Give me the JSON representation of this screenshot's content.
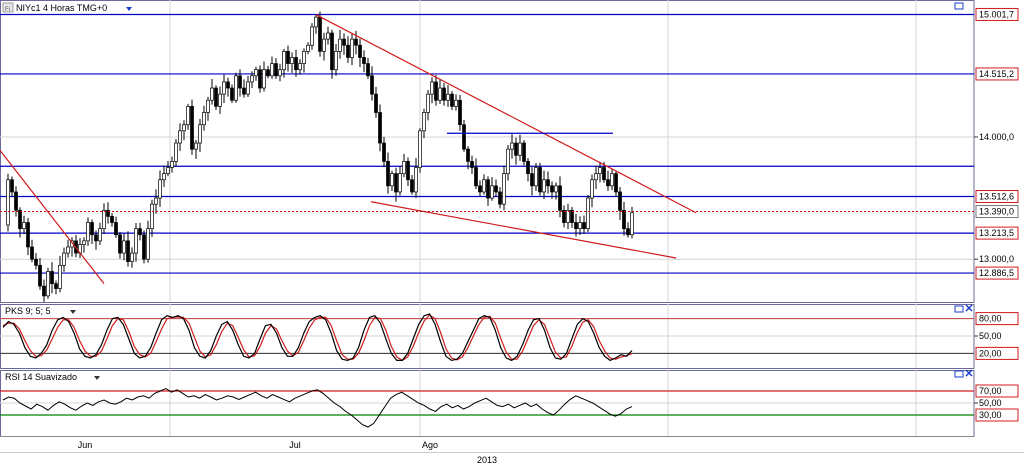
{
  "chart_title": "NIYc1 4 Horas TMG+0",
  "colors": {
    "background": "#ffffff",
    "grid": "#d4d4d4",
    "price_level": "#0000c8",
    "trendline": "#d01c1c",
    "current_price": "#c00000",
    "candle_up": "#ffffff",
    "candle_down": "#000000",
    "stoch_k": "#000000",
    "stoch_d": "#d01c1c",
    "rsi_line": "#000000",
    "rsi_upper": "#d01c1c",
    "rsi_lower": "#008000"
  },
  "icons": [
    "chart-icon",
    "dropdown-arrow-icon",
    "maximize-icon",
    "close-icon"
  ],
  "chart_data": [
    {
      "type": "candlestick",
      "title": "NIYc1 4 Horas TMG+0",
      "ylim": [
        12650,
        15120
      ],
      "y_ticks": [
        13000,
        14000
      ],
      "y_tick_labels": [
        "13.000,0",
        "14.000,0"
      ],
      "grid": true,
      "price_labels": [
        {
          "value": 15001.7,
          "label": "15.001,7"
        },
        {
          "value": 14515.2,
          "label": "14.515,2"
        },
        {
          "value": 13512.6,
          "label": "13.512,6"
        },
        {
          "value": 13390.0,
          "label": "13.390,0"
        },
        {
          "value": 13213.5,
          "label": "13.213,5"
        },
        {
          "value": 12886.5,
          "label": "12.886,5"
        }
      ],
      "horizontal_levels": [
        15001.7,
        14515.2,
        13760,
        13512.6,
        13213.5,
        12886.5
      ],
      "current_price": 13390.0,
      "trendlines": [
        {
          "x": [
            0,
            104
          ],
          "y": [
            13890,
            12800
          ]
        },
        {
          "x": [
            316,
            696
          ],
          "y": [
            15000,
            13380
          ]
        },
        {
          "x": [
            371,
            676
          ],
          "y": [
            13470,
            13010
          ]
        },
        {
          "x": [
            447,
            613
          ],
          "y": [
            14030,
            14030
          ]
        }
      ],
      "close_path": [
        [
          3,
          13280
        ],
        [
          8,
          13650
        ],
        [
          12,
          13550
        ],
        [
          16,
          13400
        ],
        [
          20,
          13250
        ],
        [
          24,
          13300
        ],
        [
          28,
          13100
        ],
        [
          32,
          13000
        ],
        [
          36,
          12950
        ],
        [
          40,
          12780
        ],
        [
          44,
          12700
        ],
        [
          48,
          12900
        ],
        [
          52,
          12800
        ],
        [
          56,
          12760
        ],
        [
          60,
          12950
        ],
        [
          64,
          13050
        ],
        [
          68,
          13100
        ],
        [
          72,
          13150
        ],
        [
          76,
          13050
        ],
        [
          80,
          13120
        ],
        [
          84,
          13150
        ],
        [
          88,
          13300
        ],
        [
          92,
          13200
        ],
        [
          96,
          13150
        ],
        [
          100,
          13250
        ],
        [
          104,
          13400
        ],
        [
          108,
          13350
        ],
        [
          112,
          13300
        ],
        [
          116,
          13200
        ],
        [
          120,
          13050
        ],
        [
          124,
          13150
        ],
        [
          128,
          12980
        ],
        [
          132,
          13050
        ],
        [
          136,
          13250
        ],
        [
          140,
          13200
        ],
        [
          144,
          13000
        ],
        [
          148,
          13250
        ],
        [
          152,
          13450
        ],
        [
          156,
          13500
        ],
        [
          160,
          13650
        ],
        [
          164,
          13700
        ],
        [
          168,
          13750
        ],
        [
          172,
          13800
        ],
        [
          176,
          13950
        ],
        [
          180,
          14050
        ],
        [
          184,
          14100
        ],
        [
          188,
          14250
        ],
        [
          192,
          13900
        ],
        [
          196,
          13950
        ],
        [
          200,
          14100
        ],
        [
          204,
          14200
        ],
        [
          208,
          14300
        ],
        [
          212,
          14400
        ],
        [
          216,
          14250
        ],
        [
          220,
          14350
        ],
        [
          224,
          14450
        ],
        [
          228,
          14400
        ],
        [
          232,
          14300
        ],
        [
          236,
          14500
        ],
        [
          240,
          14400
        ],
        [
          244,
          14350
        ],
        [
          248,
          14450
        ],
        [
          252,
          14500
        ],
        [
          256,
          14550
        ],
        [
          260,
          14400
        ],
        [
          264,
          14550
        ],
        [
          268,
          14500
        ],
        [
          272,
          14600
        ],
        [
          276,
          14500
        ],
        [
          280,
          14550
        ],
        [
          284,
          14700
        ],
        [
          288,
          14600
        ],
        [
          292,
          14650
        ],
        [
          296,
          14550
        ],
        [
          300,
          14600
        ],
        [
          304,
          14700
        ],
        [
          308,
          14750
        ],
        [
          312,
          14900
        ],
        [
          316,
          14980
        ],
        [
          320,
          14700
        ],
        [
          324,
          14800
        ],
        [
          328,
          14850
        ],
        [
          332,
          14550
        ],
        [
          336,
          14700
        ],
        [
          340,
          14800
        ],
        [
          344,
          14750
        ],
        [
          348,
          14650
        ],
        [
          352,
          14800
        ],
        [
          356,
          14750
        ],
        [
          360,
          14650
        ],
        [
          364,
          14600
        ],
        [
          368,
          14500
        ],
        [
          372,
          14350
        ],
        [
          376,
          14200
        ],
        [
          380,
          13950
        ],
        [
          384,
          13800
        ],
        [
          388,
          13600
        ],
        [
          392,
          13700
        ],
        [
          396,
          13550
        ],
        [
          400,
          13700
        ],
        [
          404,
          13800
        ],
        [
          408,
          13650
        ],
        [
          412,
          13550
        ],
        [
          416,
          13750
        ],
        [
          420,
          14050
        ],
        [
          424,
          14200
        ],
        [
          428,
          14350
        ],
        [
          432,
          14450
        ],
        [
          436,
          14300
        ],
        [
          440,
          14400
        ],
        [
          444,
          14300
        ],
        [
          448,
          14350
        ],
        [
          452,
          14250
        ],
        [
          456,
          14300
        ],
        [
          460,
          14100
        ],
        [
          464,
          13900
        ],
        [
          468,
          13800
        ],
        [
          472,
          13750
        ],
        [
          476,
          13600
        ],
        [
          480,
          13550
        ],
        [
          484,
          13650
        ],
        [
          488,
          13500
        ],
        [
          492,
          13600
        ],
        [
          496,
          13550
        ],
        [
          500,
          13450
        ],
        [
          504,
          13700
        ],
        [
          508,
          13900
        ],
        [
          512,
          13950
        ],
        [
          516,
          13850
        ],
        [
          520,
          13950
        ],
        [
          524,
          13800
        ],
        [
          528,
          13700
        ],
        [
          532,
          13600
        ],
        [
          536,
          13750
        ],
        [
          540,
          13550
        ],
        [
          544,
          13650
        ],
        [
          548,
          13600
        ],
        [
          552,
          13550
        ],
        [
          556,
          13600
        ],
        [
          560,
          13400
        ],
        [
          564,
          13300
        ],
        [
          568,
          13400
        ],
        [
          572,
          13300
        ],
        [
          576,
          13250
        ],
        [
          580,
          13300
        ],
        [
          584,
          13250
        ],
        [
          588,
          13500
        ],
        [
          592,
          13650
        ],
        [
          596,
          13700
        ],
        [
          600,
          13750
        ],
        [
          604,
          13650
        ],
        [
          608,
          13600
        ],
        [
          612,
          13700
        ],
        [
          616,
          13550
        ],
        [
          620,
          13400
        ],
        [
          624,
          13250
        ],
        [
          628,
          13200
        ],
        [
          632,
          13380
        ]
      ]
    },
    {
      "type": "line",
      "title": "PKS 9; 5; 5",
      "ylim": [
        0,
        100
      ],
      "y_ticks": [
        20,
        50,
        80
      ],
      "y_tick_labels": [
        "20,00",
        "50,00",
        "80,00"
      ],
      "reference_lines": [
        80,
        20
      ],
      "series": [
        {
          "values": [
            65,
            75,
            70,
            55,
            30,
            15,
            12,
            20,
            35,
            60,
            78,
            82,
            75,
            55,
            28,
            15,
            12,
            18,
            35,
            60,
            80,
            82,
            70,
            45,
            20,
            12,
            15,
            30,
            55,
            78,
            85,
            82,
            85,
            80,
            60,
            30,
            15,
            12,
            25,
            50,
            70,
            75,
            60,
            35,
            15,
            12,
            20,
            45,
            68,
            70,
            55,
            30,
            15,
            15,
            30,
            55,
            75,
            82,
            85,
            78,
            55,
            25,
            10,
            8,
            12,
            30,
            60,
            82,
            85,
            72,
            45,
            20,
            8,
            8,
            20,
            45,
            70,
            85,
            88,
            70,
            40,
            15,
            8,
            10,
            20,
            40,
            60,
            80,
            85,
            82,
            60,
            30,
            12,
            8,
            15,
            35,
            60,
            78,
            80,
            60,
            30,
            12,
            10,
            20,
            45,
            70,
            80,
            75,
            55,
            30,
            15,
            8,
            12,
            18,
            15,
            25
          ]
        },
        {
          "values": [
            68,
            72,
            72,
            62,
            42,
            25,
            15,
            16,
            26,
            45,
            65,
            78,
            78,
            65,
            42,
            24,
            15,
            15,
            24,
            45,
            68,
            80,
            78,
            58,
            32,
            18,
            14,
            20,
            40,
            62,
            80,
            82,
            83,
            82,
            72,
            48,
            24,
            14,
            18,
            35,
            58,
            72,
            68,
            48,
            26,
            14,
            16,
            32,
            55,
            68,
            62,
            42,
            24,
            16,
            22,
            42,
            64,
            78,
            82,
            82,
            68,
            42,
            18,
            10,
            10,
            20,
            42,
            68,
            82,
            80,
            60,
            32,
            14,
            8,
            14,
            32,
            56,
            76,
            86,
            80,
            56,
            28,
            12,
            9,
            14,
            30,
            50,
            70,
            82,
            84,
            72,
            46,
            22,
            10,
            10,
            24,
            46,
            68,
            78,
            70,
            46,
            22,
            12,
            14,
            32,
            56,
            74,
            78,
            66,
            42,
            24,
            12,
            10,
            14,
            16,
            20
          ]
        }
      ]
    },
    {
      "type": "line",
      "title": "RSI 14 Suavizado",
      "ylim": [
        0,
        100
      ],
      "y_ticks": [
        30,
        50,
        70
      ],
      "y_tick_labels": [
        "30,00",
        "50,00",
        "70,00"
      ],
      "reference_lines": [
        70,
        30
      ],
      "series": [
        {
          "values": [
            55,
            60,
            58,
            50,
            45,
            40,
            48,
            44,
            38,
            46,
            52,
            48,
            42,
            38,
            45,
            50,
            46,
            52,
            55,
            50,
            48,
            52,
            58,
            55,
            60,
            62,
            58,
            66,
            70,
            74,
            68,
            72,
            66,
            60,
            62,
            58,
            64,
            60,
            55,
            58,
            62,
            60,
            56,
            60,
            64,
            68,
            62,
            58,
            64,
            60,
            56,
            52,
            58,
            62,
            66,
            70,
            72,
            66,
            58,
            50,
            44,
            36,
            30,
            22,
            14,
            10,
            16,
            30,
            44,
            58,
            64,
            68,
            62,
            56,
            50,
            46,
            40,
            36,
            44,
            48,
            42,
            46,
            40,
            44,
            50,
            54,
            58,
            52,
            46,
            44,
            48,
            42,
            46,
            50,
            44,
            48,
            40,
            34,
            30,
            38,
            48,
            56,
            62,
            58,
            54,
            50,
            44,
            38,
            32,
            28,
            32,
            40,
            44
          ]
        }
      ]
    }
  ],
  "x_axis": {
    "months": [
      "Jun",
      "Jul",
      "Ago"
    ],
    "year": "2013"
  },
  "panels": {
    "price": {
      "header": "NIYc1 4 Horas TMG+0"
    },
    "stoch": {
      "header": "PKS 9; 5; 5"
    },
    "rsi": {
      "header": "RSI 14 Suavizado"
    }
  }
}
